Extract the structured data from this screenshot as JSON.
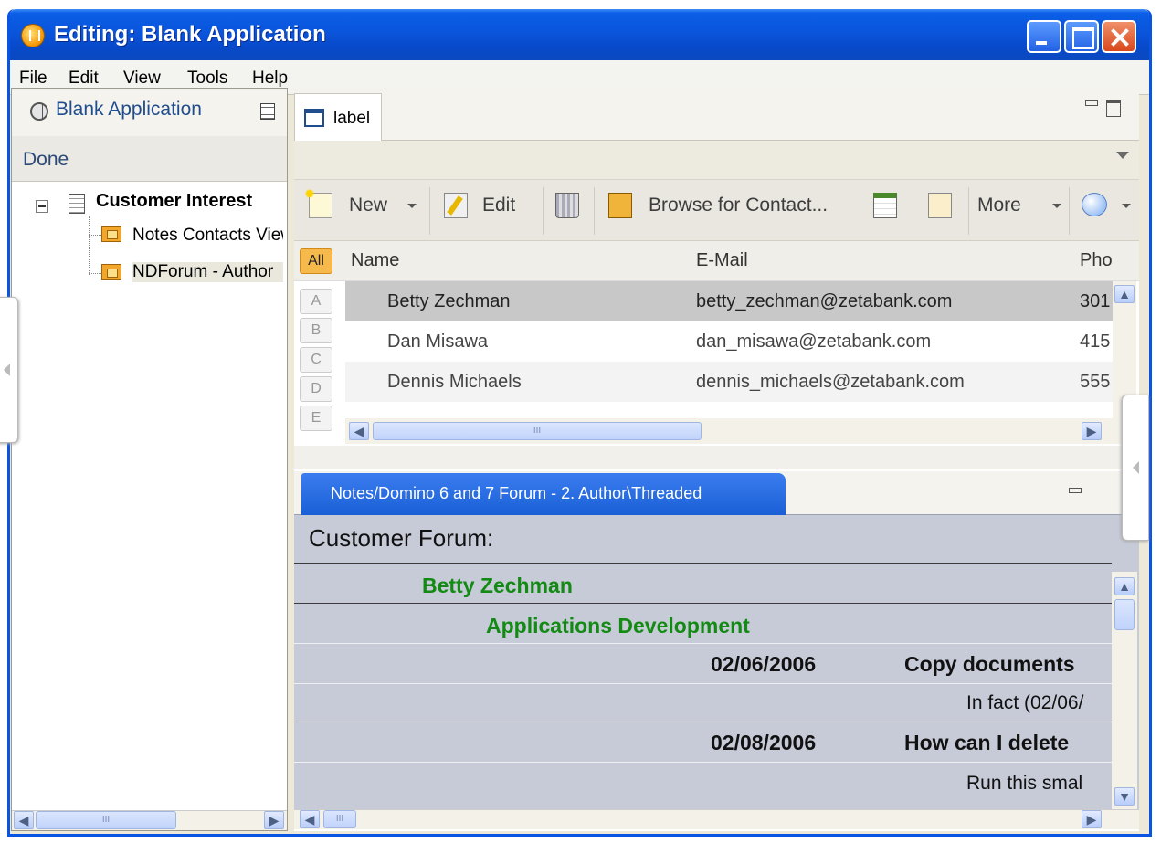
{
  "window": {
    "title": "Editing: Blank Application"
  },
  "menu": [
    "File",
    "Edit",
    "View",
    "Tools",
    "Help"
  ],
  "left_pane": {
    "title": "Blank Application",
    "done_label": "Done",
    "tree": {
      "root": "Customer Interest",
      "children": [
        "Notes Contacts View",
        "NDForum - Author"
      ]
    },
    "scroll_thumb_glyph": "III"
  },
  "view_tab": {
    "label": "label"
  },
  "toolbar": {
    "new_label": "New",
    "edit_label": "Edit",
    "browse_label": "Browse for Contact...",
    "more_label": "More"
  },
  "table": {
    "columns": [
      "Name",
      "E-Mail",
      "Pho"
    ],
    "index_letters": [
      "All",
      "A",
      "B",
      "C",
      "D",
      "E"
    ],
    "rows": [
      {
        "name": "Betty Zechman",
        "email": "betty_zechman@zetabank.com",
        "phone": "301"
      },
      {
        "name": "Dan Misawa",
        "email": "dan_misawa@zetabank.com",
        "phone": "415"
      },
      {
        "name": "Dennis Michaels",
        "email": "dennis_michaels@zetabank.com",
        "phone": "555"
      }
    ]
  },
  "lower_tab": {
    "label": "Notes/Domino 6 and 7 Forum - 2. Author\\Threaded"
  },
  "forum": {
    "title": "Customer Forum:",
    "author": "Betty Zechman",
    "category": "Applications Development",
    "entries": [
      {
        "date": "02/06/2006",
        "subject": "Copy documents",
        "reply": "In fact  (02/06/"
      },
      {
        "date": "02/08/2006",
        "subject": "How can I delete",
        "reply": "Run this smal"
      }
    ]
  },
  "colors": {
    "titlebar": "#0a55dc",
    "forum_bg": "#c7cbd8",
    "forum_green": "#138a13",
    "selected_tab": "#1a5fd6"
  }
}
